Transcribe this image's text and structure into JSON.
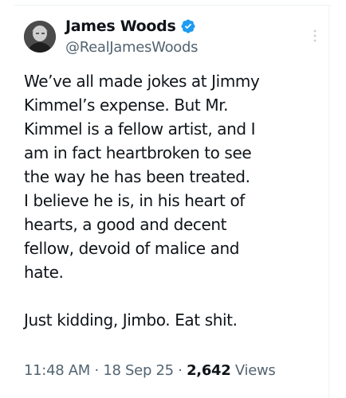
{
  "author": {
    "display_name": "James Woods",
    "handle": "@RealJamesWoods",
    "verified_icon": "verified-badge-icon",
    "verified_color": "#1d9bf0",
    "avatar": "avatar-photo"
  },
  "tweet": {
    "paragraph_1": [
      "We’ve all made jokes at Jimmy",
      "Kimmel’s expense. But Mr.",
      "Kimmel is a fellow artist, and I",
      "am in fact heartbroken to see",
      "the way he has been treated.",
      "I believe he is, in his heart of",
      "hearts, a good and decent",
      "fellow, devoid of malice and",
      "hate."
    ],
    "paragraph_2": [
      "Just kidding, Jimbo. Eat shit."
    ]
  },
  "meta": {
    "time": "11:48 AM",
    "separator": "·",
    "date": "18 Sep 25",
    "views_count": "2,642",
    "views_label": "Views"
  },
  "actions": {
    "more_icon": "more-options-icon"
  },
  "colors": {
    "text_primary": "#0f1419",
    "text_secondary": "#536471",
    "border": "#eff3f4"
  }
}
